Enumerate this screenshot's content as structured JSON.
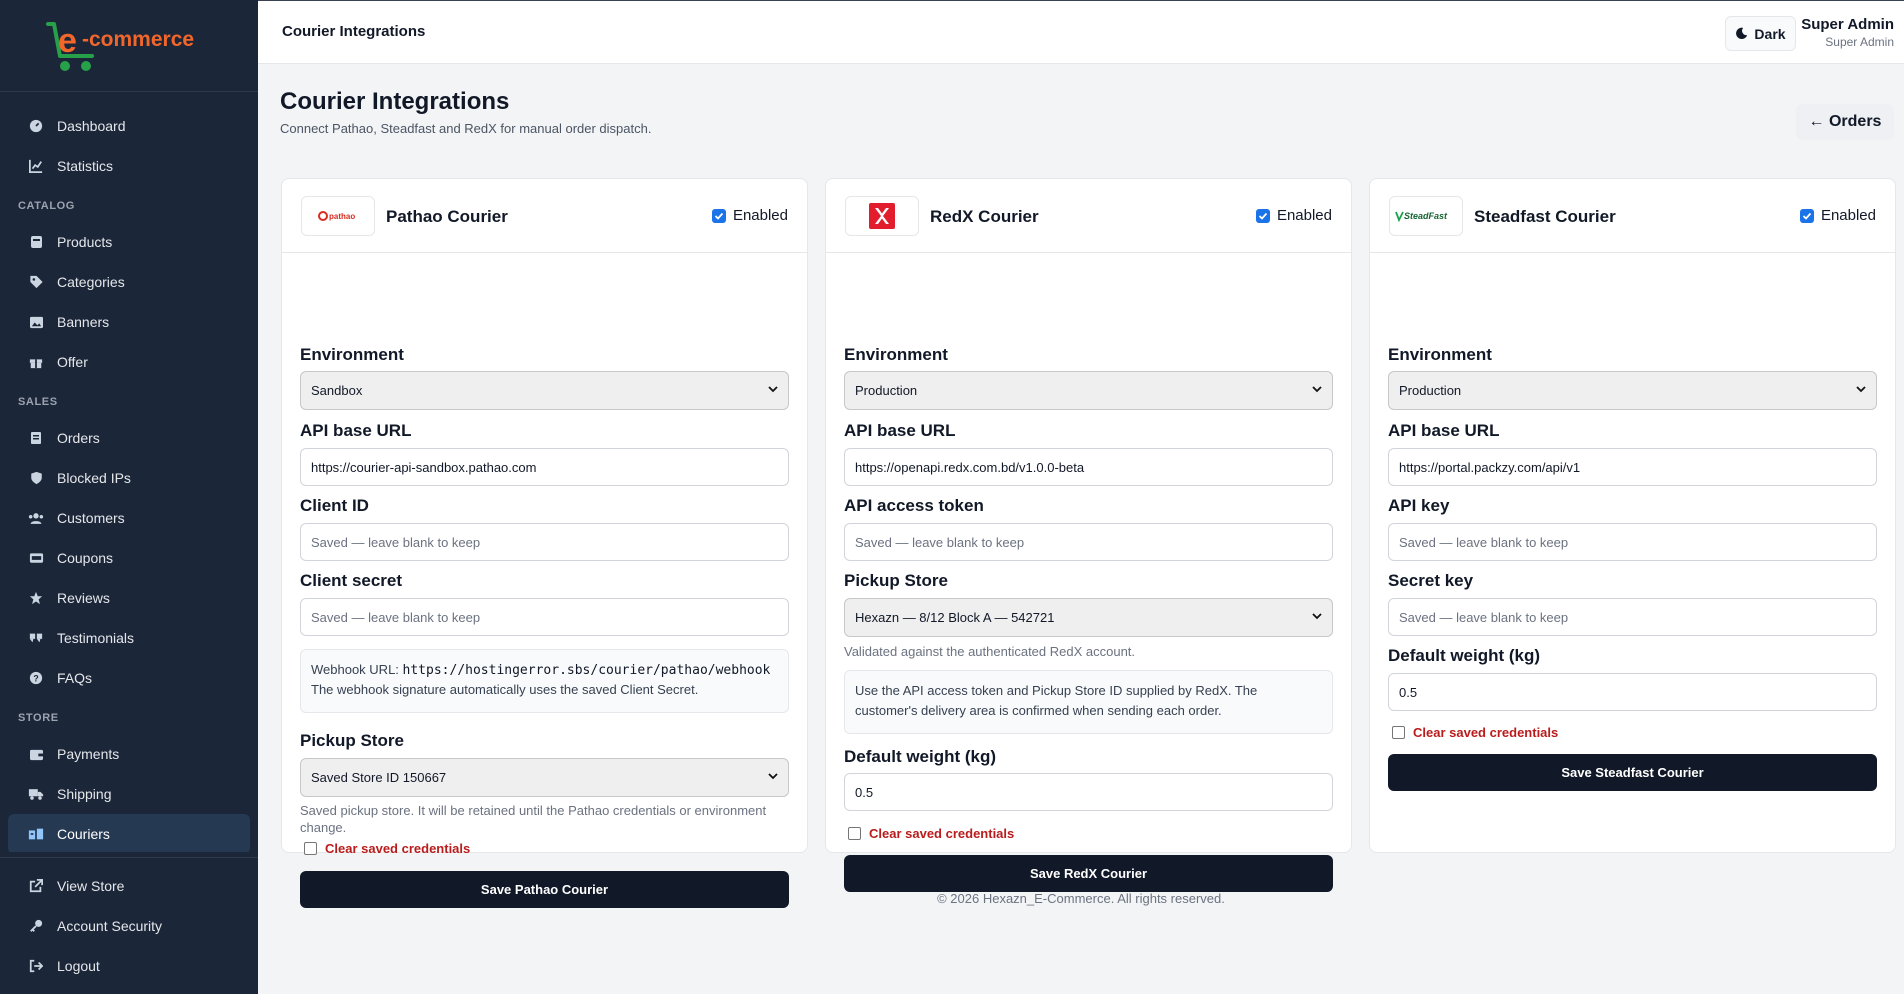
{
  "brand": {
    "name": "e-commerce",
    "accent": "#f2662b",
    "logo_green": "#27a04a"
  },
  "topbar": {
    "title": "Courier Integrations",
    "dark_label": "Dark",
    "user_name": "Super Admin",
    "user_role": "Super Admin"
  },
  "sidebar": {
    "items_main": [
      {
        "label": "Dashboard",
        "icon": "gauge-icon"
      },
      {
        "label": "Statistics",
        "icon": "chart-line-icon"
      }
    ],
    "section_catalog": "CATALOG",
    "items_catalog": [
      {
        "label": "Products",
        "icon": "box-icon"
      },
      {
        "label": "Categories",
        "icon": "tags-icon"
      },
      {
        "label": "Banners",
        "icon": "image-icon"
      },
      {
        "label": "Offer",
        "icon": "gift-icon"
      }
    ],
    "section_sales": "SALES",
    "items_sales": [
      {
        "label": "Orders",
        "icon": "receipt-icon"
      },
      {
        "label": "Blocked IPs",
        "icon": "shield-icon"
      },
      {
        "label": "Customers",
        "icon": "users-icon"
      },
      {
        "label": "Coupons",
        "icon": "ticket-icon"
      },
      {
        "label": "Reviews",
        "icon": "star-icon"
      },
      {
        "label": "Testimonials",
        "icon": "quote-icon"
      },
      {
        "label": "FAQs",
        "icon": "question-icon"
      }
    ],
    "section_store": "STORE",
    "items_store": [
      {
        "label": "Payments",
        "icon": "wallet-icon"
      },
      {
        "label": "Shipping",
        "icon": "truck-icon"
      },
      {
        "label": "Couriers",
        "icon": "courier-icon",
        "active": true
      }
    ],
    "items_bottom": [
      {
        "label": "View Store",
        "icon": "external-link-icon"
      },
      {
        "label": "Account Security",
        "icon": "key-icon"
      },
      {
        "label": "Logout",
        "icon": "logout-icon"
      }
    ]
  },
  "page": {
    "title": "Courier Integrations",
    "subtitle": "Connect Pathao, Steadfast and RedX for manual order dispatch.",
    "orders_button": "← Orders"
  },
  "pathao": {
    "name": "Pathao Courier",
    "logo_text": "pathao",
    "enabled_label": "Enabled",
    "env_label": "Environment",
    "env_value": "Sandbox",
    "url_label": "API base URL",
    "url_value": "https://courier-api-sandbox.pathao.com",
    "client_id_label": "Client ID",
    "client_id_placeholder": "Saved — leave blank to keep",
    "client_secret_label": "Client secret",
    "client_secret_placeholder": "Saved — leave blank to keep",
    "webhook_prefix": "Webhook URL: ",
    "webhook_url": "https://hostingerror.sbs/courier/pathao/webhook",
    "webhook_note": "The webhook signature automatically uses the saved Client Secret.",
    "store_label": "Pickup Store",
    "store_value": "Saved Store ID 150667",
    "store_help": "Saved pickup store. It will be retained until the Pathao credentials or environment change.",
    "clear_label": "Clear saved credentials",
    "save_label": "Save Pathao Courier"
  },
  "redx": {
    "name": "RedX Courier",
    "enabled_label": "Enabled",
    "env_label": "Environment",
    "env_value": "Production",
    "url_label": "API base URL",
    "url_value": "https://openapi.redx.com.bd/v1.0.0-beta",
    "token_label": "API access token",
    "token_placeholder": "Saved — leave blank to keep",
    "store_label": "Pickup Store",
    "store_value": "Hexazn — 8/12 Block A — 542721",
    "store_help": "Validated against the authenticated RedX account.",
    "info_note": "Use the API access token and Pickup Store ID supplied by RedX. The customer's delivery area is confirmed when sending each order.",
    "weight_label": "Default weight (kg)",
    "weight_value": "0.5",
    "clear_label": "Clear saved credentials",
    "save_label": "Save RedX Courier"
  },
  "steadfast": {
    "name": "Steadfast Courier",
    "logo_text": "SteadFast",
    "enabled_label": "Enabled",
    "env_label": "Environment",
    "env_value": "Production",
    "url_label": "API base URL",
    "url_value": "https://portal.packzy.com/api/v1",
    "key_label": "API key",
    "key_placeholder": "Saved — leave blank to keep",
    "secret_label": "Secret key",
    "secret_placeholder": "Saved — leave blank to keep",
    "weight_label": "Default weight (kg)",
    "weight_value": "0.5",
    "clear_label": "Clear saved credentials",
    "save_label": "Save Steadfast Courier"
  },
  "footer": "© 2026 Hexazn_E-Commerce. All rights reserved."
}
